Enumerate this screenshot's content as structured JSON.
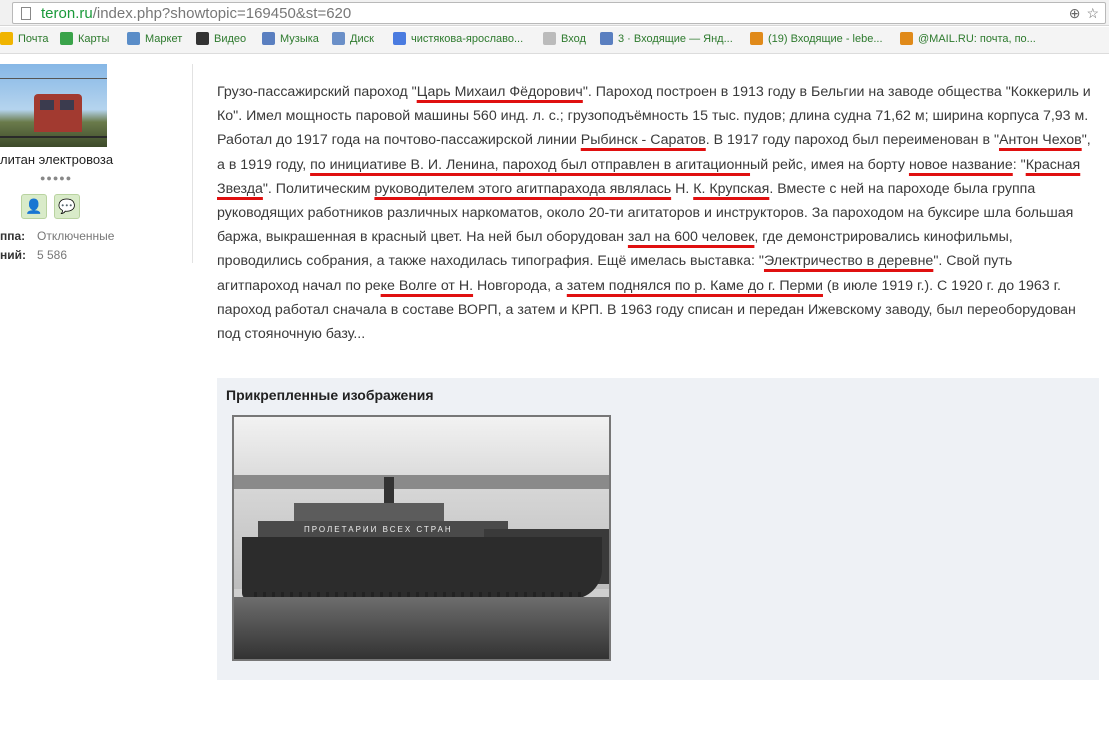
{
  "browser": {
    "url_host": "teron.ru",
    "url_path": "/index.php?showtopic=169450&st=620",
    "zoom_icon": "zoom-icon",
    "star_icon": "star-icon"
  },
  "bookmarks": [
    {
      "label": "Почта",
      "icon": "mail-icon",
      "color": "#f0b400"
    },
    {
      "label": "Карты",
      "icon": "maps-icon",
      "color": "#3aa34a"
    },
    {
      "label": "Маркет",
      "icon": "market-icon",
      "color": "#5a8dc8"
    },
    {
      "label": "Видео",
      "icon": "video-icon",
      "color": "#333333"
    },
    {
      "label": "Музыка",
      "icon": "music-icon",
      "color": "#5a7fc0"
    },
    {
      "label": "Диск",
      "icon": "disk-icon",
      "color": "#6a8fc8"
    },
    {
      "label": "чистякова-ярославо...",
      "icon": "google-icon",
      "color": "#4a7be0"
    },
    {
      "label": "Вход",
      "icon": "page-icon",
      "color": "#bbbbbb"
    },
    {
      "label": "3 · Входящие — Янд...",
      "icon": "mail-icon",
      "color": "#5a7fc0"
    },
    {
      "label": "(19) Входящие - lebe...",
      "icon": "at-icon",
      "color": "#e08a1a"
    },
    {
      "label": "@MAIL.RU: почта, по...",
      "icon": "at-icon",
      "color": "#e08a1a"
    }
  ],
  "profile": {
    "rank": "литан электровоза",
    "pips": "●●●●●",
    "group_label": "ппа:",
    "group_value": "Отключенные",
    "posts_label": "ний:",
    "posts_value": "5 586"
  },
  "post": {
    "segments": [
      {
        "t": "Грузо-пассажирский пароход \""
      },
      {
        "t": "Царь Михаил Фёдорович",
        "u": true
      },
      {
        "t": "\". Пароход построен в 1913 году в Бельгии на заводе общества \"Коккериль и Ко\". Имел мощность паровой машины 560 инд. л. с.; грузоподъёмность 15 тыс. пудов; длина судна 71,62 м; ширина корпуса 7,93 м. Работал до 1917 года на почтово-пассажирской линии "
      },
      {
        "t": "Рыбинск - Саратов",
        "u": true
      },
      {
        "t": ". В 1917 году пароход был переименован в \""
      },
      {
        "t": "Антон Чехов",
        "u": true
      },
      {
        "t": "\", а в 1919 году, "
      },
      {
        "t": "по инициативе В. И. Ленина, пароход был отправлен в агитационн",
        "u": true
      },
      {
        "t": "ый рейс, имея на борту "
      },
      {
        "t": "новое название",
        "u": true
      },
      {
        "t": ": \""
      },
      {
        "t": "Красная Звезда",
        "u": true
      },
      {
        "t": "\". Политическим "
      },
      {
        "t": "руководителем этого агитпарахода являлась",
        "u": true
      },
      {
        "t": " Н. "
      },
      {
        "t": "К. Крупская",
        "u": true
      },
      {
        "t": ". Вместе с ней на пароходе была группа руководящих работников различных наркоматов, около 20-ти агитаторов и инструкторов. За пароходом на буксире шла большая баржа, выкрашенная в красный цвет. На ней был оборудован "
      },
      {
        "t": "зал на 600 человек",
        "u": true
      },
      {
        "t": ", где демонстрировались кинофильмы, проводились собрания, а также находилась типография. Ещё имелась выставка: \""
      },
      {
        "t": "Электричество в деревне",
        "u": true
      },
      {
        "t": "\". Свой путь агитпароход начал по ре"
      },
      {
        "t": "ке Волге от Н.",
        "u": true
      },
      {
        "t": " Новгорода, а "
      },
      {
        "t": "затем поднялся по р. Каме до г. Перми",
        "u": true
      },
      {
        "t": " (в июле 1919 г.). С 1920 г. до 1963 г. пароход работал сначала в составе ВОРП, а затем и КРП. В 1963 году списан и передан Ижевскому заводу, был переоборудован под стояночную базу..."
      }
    ]
  },
  "attachments": {
    "title": "Прикрепленные изображения",
    "photo_banner": "ПРОЛЕТАРИИ ВСЕХ СТРАН"
  },
  "colors": {
    "underline": "#e01010",
    "attach_bg": "#eef1f5",
    "link_green": "#2d7a2d"
  }
}
